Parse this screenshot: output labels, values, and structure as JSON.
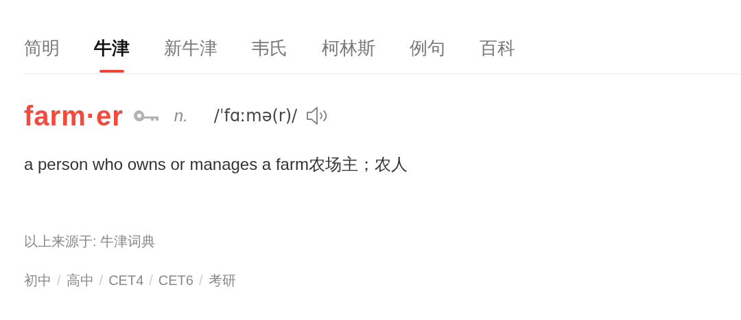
{
  "tabs": [
    {
      "label": "简明",
      "selected": false
    },
    {
      "label": "牛津",
      "selected": true
    },
    {
      "label": "新牛津",
      "selected": false
    },
    {
      "label": "韦氏",
      "selected": false
    },
    {
      "label": "柯林斯",
      "selected": false
    },
    {
      "label": "例句",
      "selected": false
    },
    {
      "label": "百科",
      "selected": false
    }
  ],
  "entry": {
    "headword": "farm·er",
    "pos": "n.",
    "phonetic": "/ˈfɑːmə(r)/",
    "definition": "a person who owns or manages a farm农场主；农人"
  },
  "source": "以上来源于: 牛津词典",
  "levels": [
    "初中",
    "高中",
    "CET4",
    "CET6",
    "考研"
  ],
  "level_separator": "/"
}
